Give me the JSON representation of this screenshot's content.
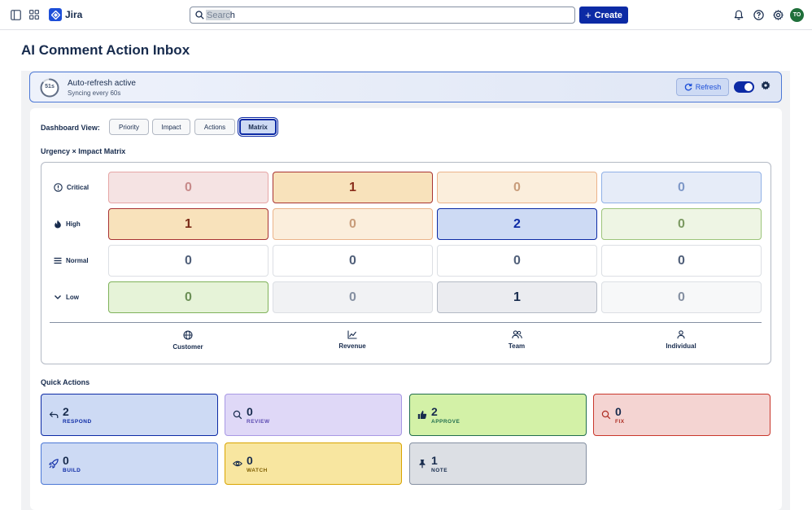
{
  "app": {
    "name": "Jira"
  },
  "topbar": {
    "search_placeholder": "Search",
    "create_label": "Create",
    "avatar_initials": "TO"
  },
  "page": {
    "title": "AI Comment Action Inbox"
  },
  "refresh": {
    "countdown": "51s",
    "countdown_progress": 0.85,
    "title": "Auto-refresh active",
    "subtitle": "Syncing every 60s",
    "button_label": "Refresh",
    "toggle_on": true
  },
  "dashboard": {
    "label": "Dashboard View:",
    "views": [
      "Priority",
      "Impact",
      "Actions",
      "Matrix"
    ],
    "active_view": "Matrix"
  },
  "matrix": {
    "title": "Urgency × Impact Matrix",
    "rows": [
      {
        "label": "Critical",
        "icon": "alert-circle-icon",
        "values": [
          "0",
          "1",
          "0",
          "0"
        ]
      },
      {
        "label": "High",
        "icon": "flame-icon",
        "values": [
          "1",
          "0",
          "2",
          "0"
        ]
      },
      {
        "label": "Normal",
        "icon": "menu-lines-icon",
        "values": [
          "0",
          "0",
          "0",
          "0"
        ]
      },
      {
        "label": "Low",
        "icon": "chevron-down-icon",
        "values": [
          "0",
          "0",
          "1",
          "0"
        ]
      }
    ],
    "columns": [
      {
        "label": "Customer",
        "icon": "globe-icon"
      },
      {
        "label": "Revenue",
        "icon": "line-chart-icon"
      },
      {
        "label": "Team",
        "icon": "people-icon"
      },
      {
        "label": "Individual",
        "icon": "person-icon"
      }
    ]
  },
  "quick_actions": {
    "title": "Quick Actions",
    "items": [
      {
        "count": "2",
        "label": "RESPOND",
        "icon": "reply-icon",
        "color": "#0c2aa5"
      },
      {
        "count": "0",
        "label": "REVIEW",
        "icon": "magnifier-icon",
        "color": "#5e4db2"
      },
      {
        "count": "2",
        "label": "APPROVE",
        "icon": "thumbs-up-icon",
        "color": "#216e4e"
      },
      {
        "count": "0",
        "label": "FIX",
        "icon": "magnifier-icon",
        "color": "#ae2e24"
      },
      {
        "count": "0",
        "label": "BUILD",
        "icon": "rocket-icon",
        "color": "#0c2aa5"
      },
      {
        "count": "0",
        "label": "WATCH",
        "icon": "eye-icon",
        "color": "#7f5f01"
      },
      {
        "count": "1",
        "label": "NOTE",
        "icon": "pushpin-icon",
        "color": "#172b4d"
      }
    ]
  }
}
